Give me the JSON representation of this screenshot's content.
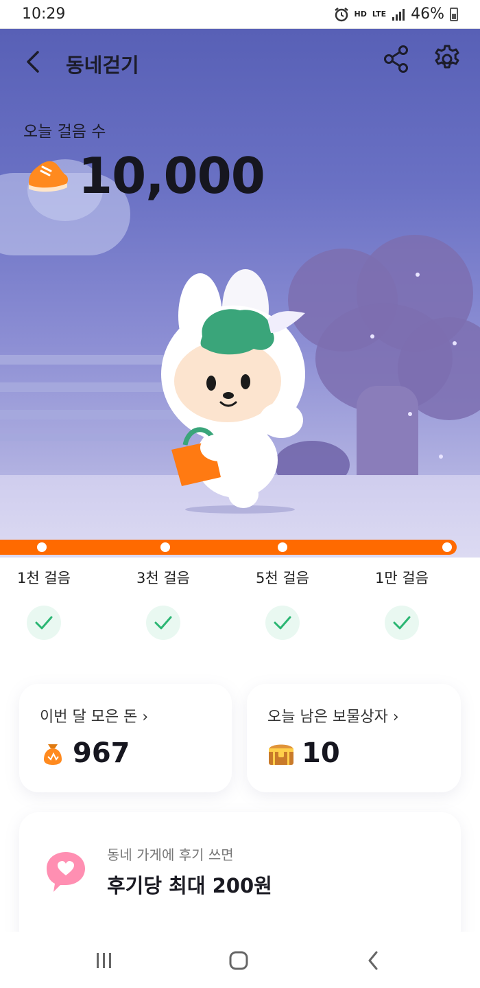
{
  "status_bar": {
    "time": "10:29",
    "network_hd": "HD",
    "network_lte": "LTE",
    "battery_percent": "46%",
    "icons": [
      "alarm-icon",
      "signal-icon",
      "battery-icon"
    ]
  },
  "header": {
    "title": "동네걷기",
    "icons": [
      "back-arrow-icon",
      "share-icon",
      "gear-icon"
    ]
  },
  "steps": {
    "label": "오늘 걸음 수",
    "value": "10,000",
    "icon": "shoe-icon"
  },
  "progress": {
    "fraction": 1.0,
    "color": "#ff6a00",
    "milestones": [
      {
        "label": "1천 걸음",
        "done": true
      },
      {
        "label": "3천 걸음",
        "done": true
      },
      {
        "label": "5천 걸음",
        "done": true
      },
      {
        "label": "1만 걸음",
        "done": true
      }
    ]
  },
  "cards": {
    "money": {
      "title": "이번 달 모은 돈",
      "value": "967",
      "icon": "money-bag-icon"
    },
    "treasure": {
      "title": "오늘 남은 보물상자",
      "value": "10",
      "icon": "treasure-chest-icon"
    }
  },
  "review": {
    "subtitle": "동네 가게에 후기 쓰면",
    "title": "후기당 최대 200원",
    "icon": "heart-speech-bubble-icon"
  },
  "nav": {
    "icons": [
      "recent-apps-icon",
      "home-icon",
      "back-icon"
    ]
  },
  "colors": {
    "accent": "#ff6a00",
    "check": "#2bb673",
    "hero_top": "#5860b6"
  }
}
